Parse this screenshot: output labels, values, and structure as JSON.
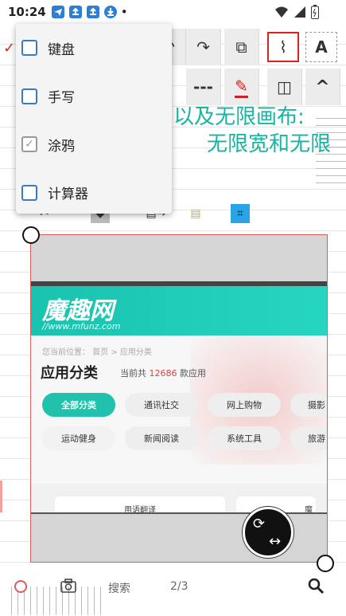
{
  "status": {
    "time": "10:24",
    "dot": "•",
    "icons": [
      "telegram-icon",
      "upload-icon",
      "upload-icon",
      "download-icon"
    ],
    "right_icons": [
      "wifi-icon",
      "signal-icon",
      "battery-icon"
    ]
  },
  "canvas": {
    "line1": "以及无限画布:",
    "line2": "无限宽和无限",
    "check": "✓"
  },
  "toolbar": {
    "undo": "↶",
    "redo": "↷",
    "copy": "⧉",
    "lasso": "⌇",
    "text": "A",
    "dash": "---",
    "pen": "✎",
    "flip": "◫",
    "collapse": "^"
  },
  "menu": {
    "items": [
      {
        "label": "键盘",
        "checked": false
      },
      {
        "label": "手写",
        "checked": false
      },
      {
        "label": "涂鸦",
        "checked": true
      },
      {
        "label": "计算器",
        "checked": false
      }
    ]
  },
  "screenshot": {
    "brand": "魔趣网",
    "url": "//www.mfunz.com",
    "breadcrumb": "您当前位置： 首页 > 应用分类",
    "heading": "应用分类",
    "count_prefix": "当前共",
    "count": "12686",
    "count_suffix": "款应用",
    "chips_row1": [
      "全部分类",
      "通讯社交",
      "网上购物",
      "摄影"
    ],
    "chips_row2": [
      "运动健身",
      "新闻阅读",
      "系统工具",
      "旅游"
    ],
    "card_left": "用语翻译",
    "card_right": "魔"
  },
  "bottom": {
    "search_label": "搜索",
    "page": "2/3",
    "search_icon": "⌕"
  },
  "colors": {
    "accent": "#19b3a2",
    "selection": "#e05a5a",
    "checkbox": "#3c78c8"
  }
}
